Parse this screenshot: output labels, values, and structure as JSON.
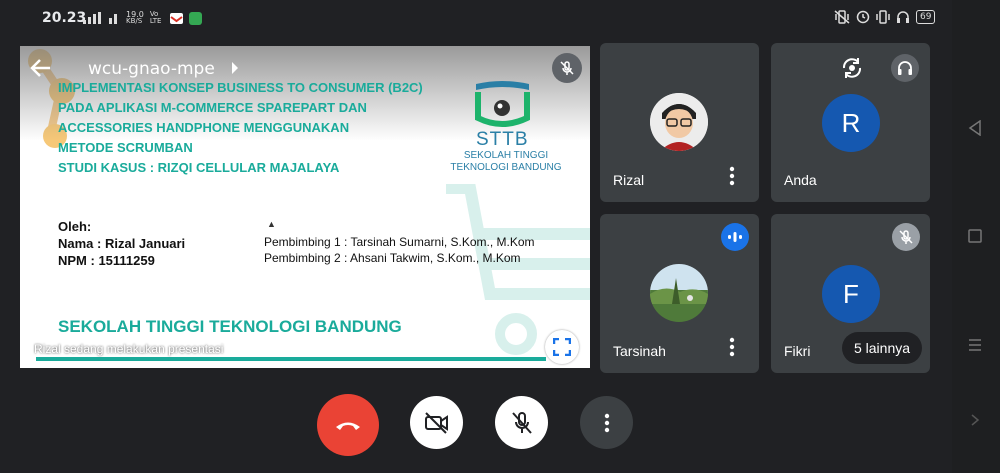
{
  "status_bar": {
    "time": "20.23",
    "speed": "19.0",
    "speed_unit": "KB/S",
    "network": "Vo LTE",
    "battery": "69"
  },
  "meeting": {
    "code": "wcu-gnao-mpe",
    "presenting_text": "Rizal sedang melakukan presentasi"
  },
  "slide": {
    "title_lines": [
      "IMPLEMENTASI KONSEP BUSINESS TO CONSUMER (B2C)",
      "PADA APLIKASI M-COMMERCE SPAREPART DAN",
      "ACCESSORIES HANDPHONE MENGGUNAKAN",
      "METODE SCRUMBAN",
      "STUDI KASUS : RIZQI CELLULAR MAJALAYA"
    ],
    "logo_name": "STTB",
    "logo_sub_1": "SEKOLAH TINGGI",
    "logo_sub_2": "TEKNOLOGI BANDUNG",
    "oleh": "Oleh:",
    "nama": "Nama  : Rizal Januari",
    "npm": "NPM   : 15111259",
    "pembimbing_1": "Pembimbing 1  : Tarsinah Sumarni, S.Kom., M.Kom",
    "pembimbing_2": "Pembimbing 2  : Ahsani Takwim, S.Kom., M.Kom",
    "school": "SEKOLAH TINGGI TEKNOLOGI BANDUNG"
  },
  "participants": [
    {
      "name": "Rizal",
      "avatar": "photo"
    },
    {
      "name": "Anda",
      "avatar_letter": "R"
    },
    {
      "name": "Tarsinah",
      "avatar": "photo",
      "speaking": true
    },
    {
      "name": "Fikri",
      "avatar_letter": "F",
      "muted": true
    }
  ],
  "more_participants": "5 lainnya",
  "colors": {
    "background": "#202124",
    "tile": "#3c4043",
    "accent_teal": "#1aab9b",
    "end_call": "#ea4335",
    "avatar_blue": "#1558b0",
    "speaking_blue": "#1a73e8"
  },
  "icons": {
    "back": "back-arrow-icon",
    "switch_camera": "switch-camera-icon",
    "audio_output": "headphones-icon",
    "end_call": "end-call-icon",
    "camera_off": "camera-off-icon",
    "mic_off": "mic-off-icon",
    "more": "more-vert-icon",
    "fullscreen": "fullscreen-icon"
  }
}
